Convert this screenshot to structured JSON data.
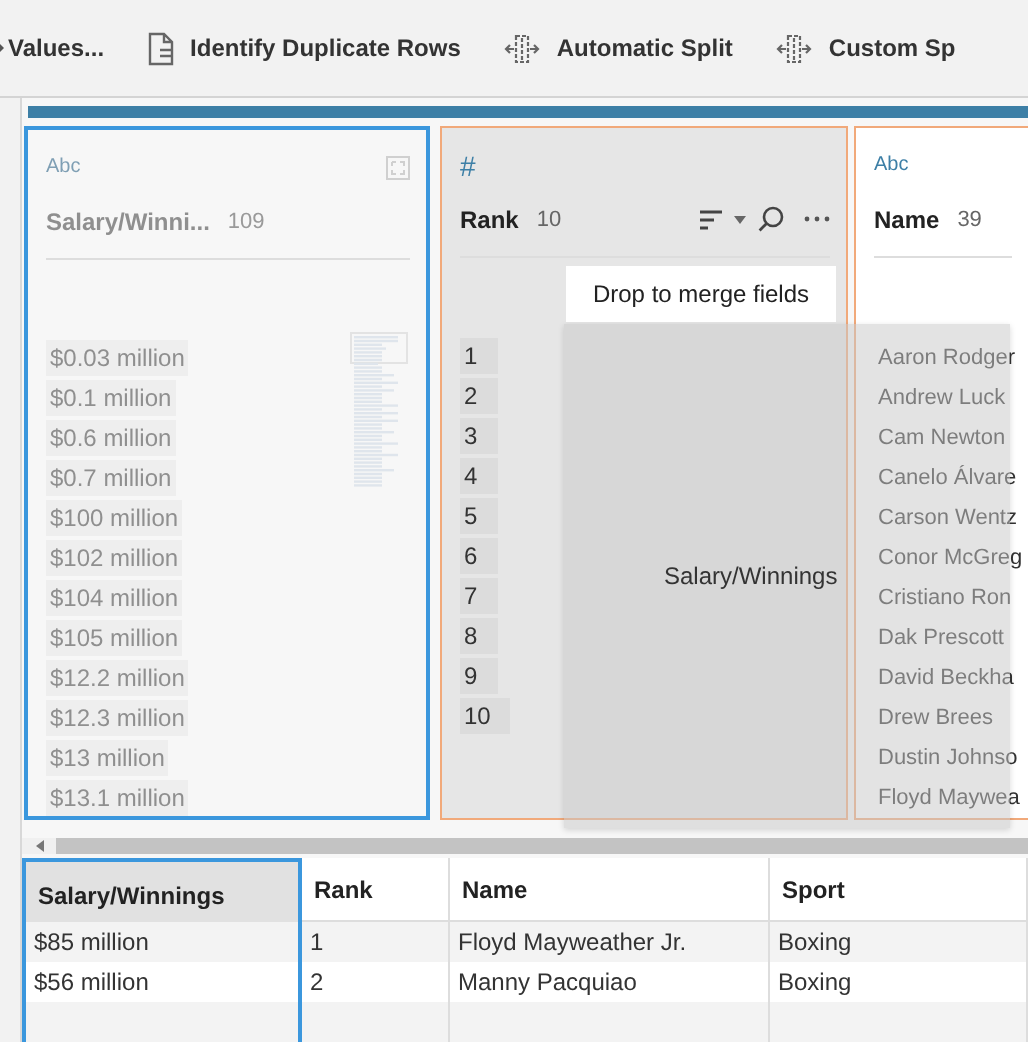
{
  "toolbar": {
    "items": [
      {
        "label": "Values..."
      },
      {
        "label": "Identify Duplicate Rows"
      },
      {
        "label": "Automatic Split"
      },
      {
        "label": "Custom Sp"
      }
    ]
  },
  "profile_cards": [
    {
      "kind": "dragged",
      "type": "Abc",
      "name": "Salary/Winni...",
      "count": "109",
      "values": [
        "$0.03 million",
        "$0.1 million",
        "$0.6 million",
        "$0.7 million",
        "$100 million",
        "$102 million",
        "$104 million",
        "$105 million",
        "$12.2 million",
        "$12.3 million",
        "$13 million",
        "$13.1 million"
      ]
    },
    {
      "kind": "hovered",
      "type": "#",
      "name": "Rank",
      "count": "10",
      "values": [
        "1",
        "2",
        "3",
        "4",
        "5",
        "6",
        "7",
        "8",
        "9",
        "10"
      ]
    },
    {
      "kind": "target",
      "type": "Abc",
      "name": "Name",
      "count": "39",
      "values": [
        "Aaron Rodger",
        "Andrew Luck",
        "Cam Newton",
        "Canelo Álvare",
        "Carson Wentz",
        "Conor McGreg",
        "Cristiano Ron",
        "Dak Prescott",
        "David Beckha",
        "Drew Brees",
        "Dustin Johnso",
        "Floyd Maywea"
      ]
    }
  ],
  "drop_tooltip": "Drop to merge fields",
  "drag_ghost": "Salary/Winnings",
  "table": {
    "columns": [
      {
        "label": "Salary/Winnings",
        "selected": true
      },
      {
        "label": "Rank",
        "selected": false
      },
      {
        "label": "Name",
        "selected": false
      },
      {
        "label": "Sport",
        "selected": false
      }
    ],
    "rows": [
      [
        "$85 million",
        "1",
        "Floyd Mayweather Jr.",
        "Boxing"
      ],
      [
        "$56 million",
        "2",
        "Manny Pacquiao",
        "Boxing"
      ]
    ]
  }
}
